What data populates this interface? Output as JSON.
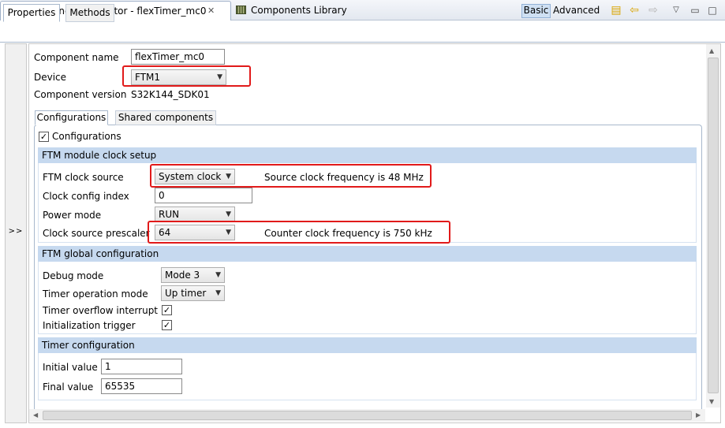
{
  "tabs": {
    "inspector_label": "*Component Inspector - flexTimer_mc0",
    "library_label": "Components Library"
  },
  "toolbar": {
    "basic_label": "Basic",
    "advanced_label": "Advanced"
  },
  "subtabs": {
    "properties_label": "Properties",
    "methods_label": "Methods"
  },
  "strip": {
    "expand_label": ">>"
  },
  "component": {
    "name_label": "Component name",
    "name_value": "flexTimer_mc0",
    "device_label": "Device",
    "device_value": "FTM1",
    "version_label": "Component version",
    "version_value": "S32K144_SDK01"
  },
  "config_tabs": {
    "configurations_label": "Configurations",
    "shared_label": "Shared components"
  },
  "configurations_checkbox_label": "Configurations",
  "clock_setup": {
    "header": "FTM module clock setup",
    "clock_source_label": "FTM clock source",
    "clock_source_value": "System clock",
    "clock_source_info": "Source clock frequency is 48 MHz",
    "config_index_label": "Clock config index",
    "config_index_value": "0",
    "power_mode_label": "Power mode",
    "power_mode_value": "RUN",
    "prescaler_label": "Clock source prescaler",
    "prescaler_value": "64",
    "prescaler_info": "Counter clock frequency is 750 kHz"
  },
  "global_config": {
    "header": "FTM global configuration",
    "debug_mode_label": "Debug mode",
    "debug_mode_value": "Mode 3",
    "operation_mode_label": "Timer operation mode",
    "operation_mode_value": "Up timer",
    "overflow_interrupt_label": "Timer overflow interrupt",
    "init_trigger_label": "Initialization trigger"
  },
  "timer_config": {
    "header": "Timer configuration",
    "initial_value_label": "Initial value",
    "initial_value": "1",
    "final_value_label": "Final value",
    "final_value": "65535"
  },
  "colors": {
    "highlight_box": "#e11a1a",
    "section_header": "#c6d9ef"
  }
}
